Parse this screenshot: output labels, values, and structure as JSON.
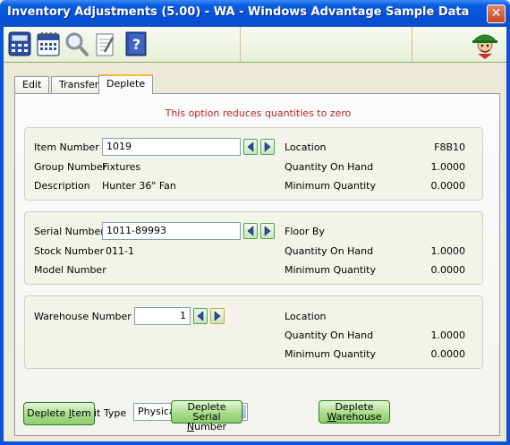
{
  "window": {
    "title": "Inventory Adjustments (5.00) - WA - Windows Advantage Sample Data",
    "close_label": "✕"
  },
  "toolbar": {
    "icons": [
      "calculator-icon",
      "calendar-icon",
      "magnifier-icon",
      "notepad-icon",
      "help-book-icon"
    ],
    "mascot": "mascot-icon"
  },
  "tabs": [
    {
      "label": "Edit",
      "active": false
    },
    {
      "label": "Transfer",
      "active": false
    },
    {
      "label": "Deplete",
      "active": true
    }
  ],
  "notice": "This option reduces quantities to zero",
  "item_group": {
    "item_number_label": "Item Number",
    "item_number": "1019",
    "group_number_label": "Group Number",
    "group_number": "Fixtures",
    "description_label": "Description",
    "description": "Hunter 36\" Fan",
    "location_label": "Location",
    "location": "F8B10",
    "qoh_label": "Quantity On Hand",
    "qoh": "1.0000",
    "min_label": "Minimum Quantity",
    "min": "0.0000"
  },
  "serial_group": {
    "serial_number_label": "Serial Number",
    "serial_number": "1011-89993",
    "stock_number_label": "Stock Number",
    "stock_number": "011-1",
    "model_number_label": "Model Number",
    "model_number": "",
    "floor_by_label": "Floor By",
    "floor_by": "",
    "qoh_label": "Quantity On Hand",
    "qoh": "1.0000",
    "min_label": "Minimum Quantity",
    "min": "0.0000"
  },
  "warehouse_group": {
    "warehouse_number_label": "Warehouse Number",
    "warehouse_number": "1",
    "location_label": "Location",
    "location": "",
    "qoh_label": "Quantity On Hand",
    "qoh": "1.0000",
    "min_label": "Minimum Quantity",
    "min": "0.0000"
  },
  "audit": {
    "label": "Record as Audit Type",
    "selected": "Physical Adjustment"
  },
  "buttons": {
    "deplete_item_pre": "Deplete ",
    "deplete_item_ul": "I",
    "deplete_item_post": "tem",
    "deplete_serial_line1": "Deplete",
    "deplete_serial_pre": "Serial ",
    "deplete_serial_ul": "N",
    "deplete_serial_post": "umber",
    "deplete_wh_line1": "Deplete",
    "deplete_wh_ul": "W",
    "deplete_wh_post": "arehouse"
  },
  "colors": {
    "accent": "#0a54d8",
    "notice": "#b0251c",
    "button_green": "#a9dc8c"
  }
}
